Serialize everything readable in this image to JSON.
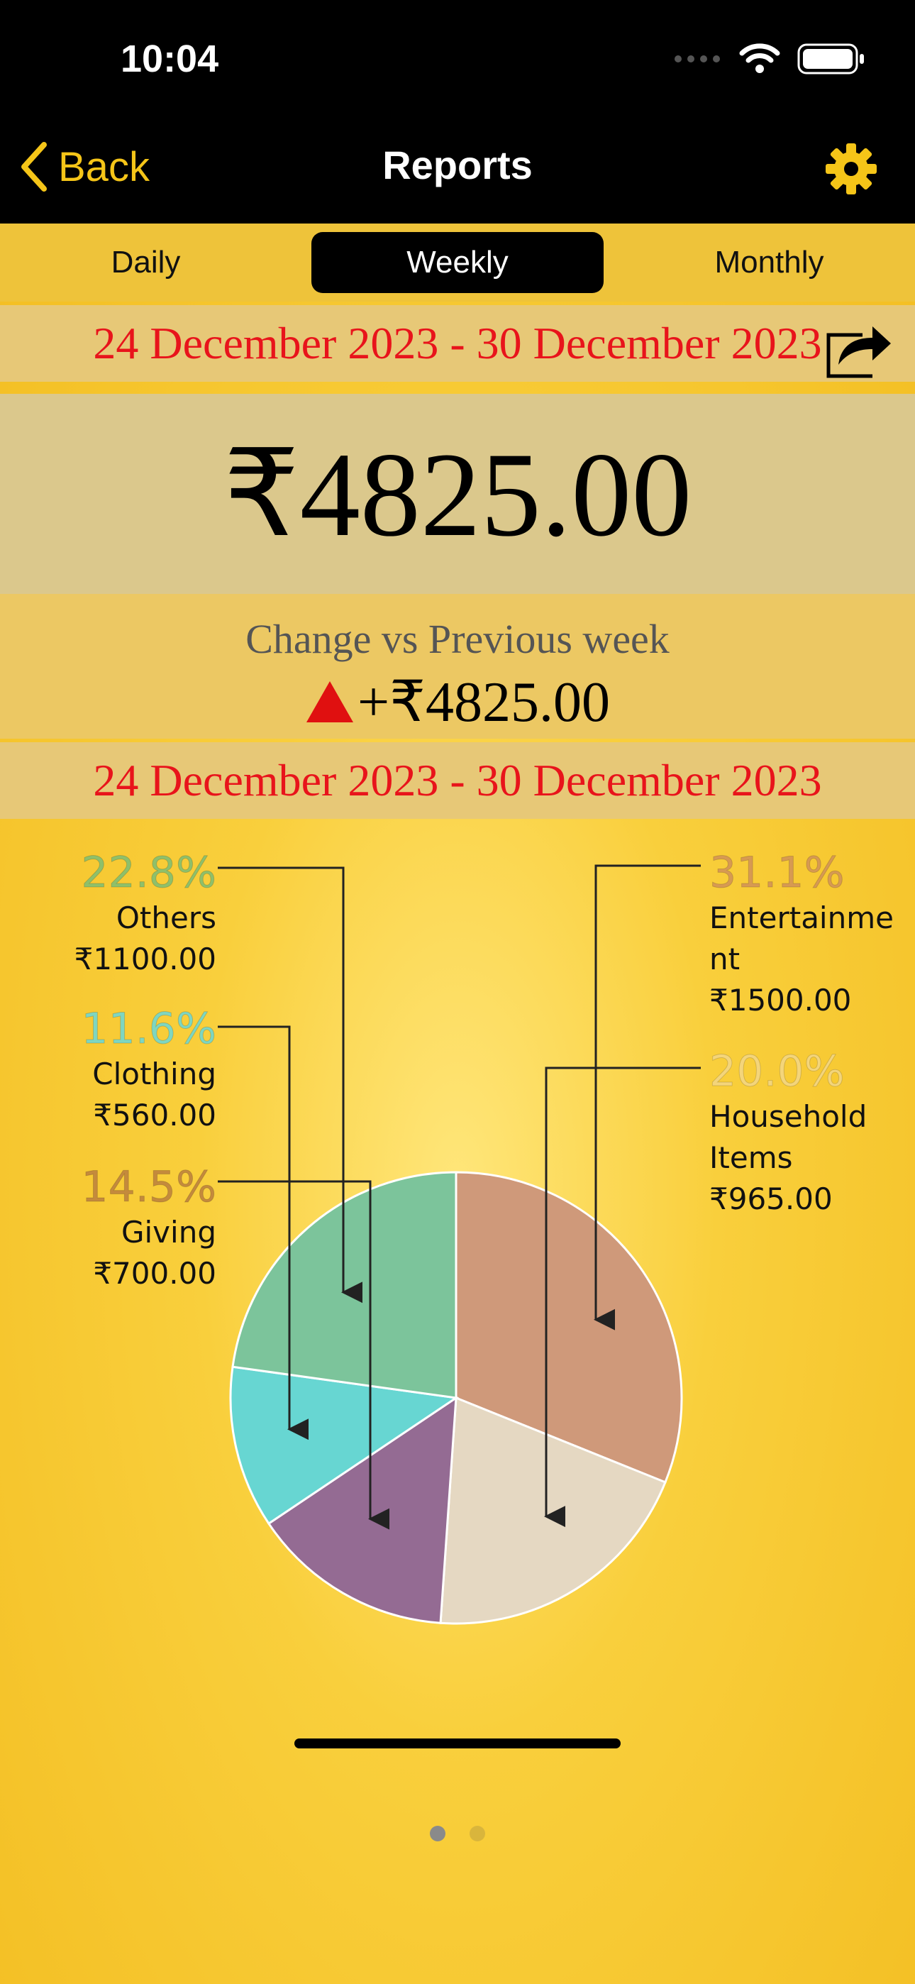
{
  "status": {
    "time": "10:04"
  },
  "nav": {
    "back_label": "Back",
    "title": "Reports"
  },
  "tabs": [
    {
      "label": "Daily",
      "active": false
    },
    {
      "label": "Weekly",
      "active": true
    },
    {
      "label": "Monthly",
      "active": false
    }
  ],
  "report": {
    "date_range_top": "24 December 2023 - 30 December 2023",
    "total": "₹4825.00",
    "change_label": "Change vs Previous week",
    "change_value": "+₹4825.00",
    "date_range_chart": "24 December 2023 - 30 December 2023"
  },
  "chart_data": {
    "type": "pie",
    "slices": [
      {
        "name": "Entertainment",
        "label_lines": [
          "Entertainme",
          "nt"
        ],
        "percent": 31.1,
        "percent_label": "31.1%",
        "amount_label": "₹1500.00",
        "color": "#cf997a",
        "text_color": "#d79a52"
      },
      {
        "name": "Household Items",
        "label_lines": [
          "Household",
          "Items"
        ],
        "percent": 20.0,
        "percent_label": "20.0%",
        "amount_label": "₹965.00",
        "color": "#e5d8c2",
        "text_color": "#f4d57a"
      },
      {
        "name": "Giving",
        "label_lines": [
          "Giving"
        ],
        "percent": 14.5,
        "percent_label": "14.5%",
        "amount_label": "₹700.00",
        "color": "#946b93",
        "text_color": "#c48a3c"
      },
      {
        "name": "Clothing",
        "label_lines": [
          "Clothing"
        ],
        "percent": 11.6,
        "percent_label": "11.6%",
        "amount_label": "₹560.00",
        "color": "#67d6d2",
        "text_color": "#7fd6c0"
      },
      {
        "name": "Others",
        "label_lines": [
          "Others"
        ],
        "percent": 22.8,
        "percent_label": "22.8%",
        "amount_label": "₹1100.00",
        "color": "#7cc49b",
        "text_color": "#8fc06a"
      }
    ]
  },
  "pager": {
    "count": 2,
    "active": 0
  },
  "colors": {
    "accent": "#f5c518",
    "date_red": "#e8141b",
    "up_arrow": "#e01010"
  }
}
